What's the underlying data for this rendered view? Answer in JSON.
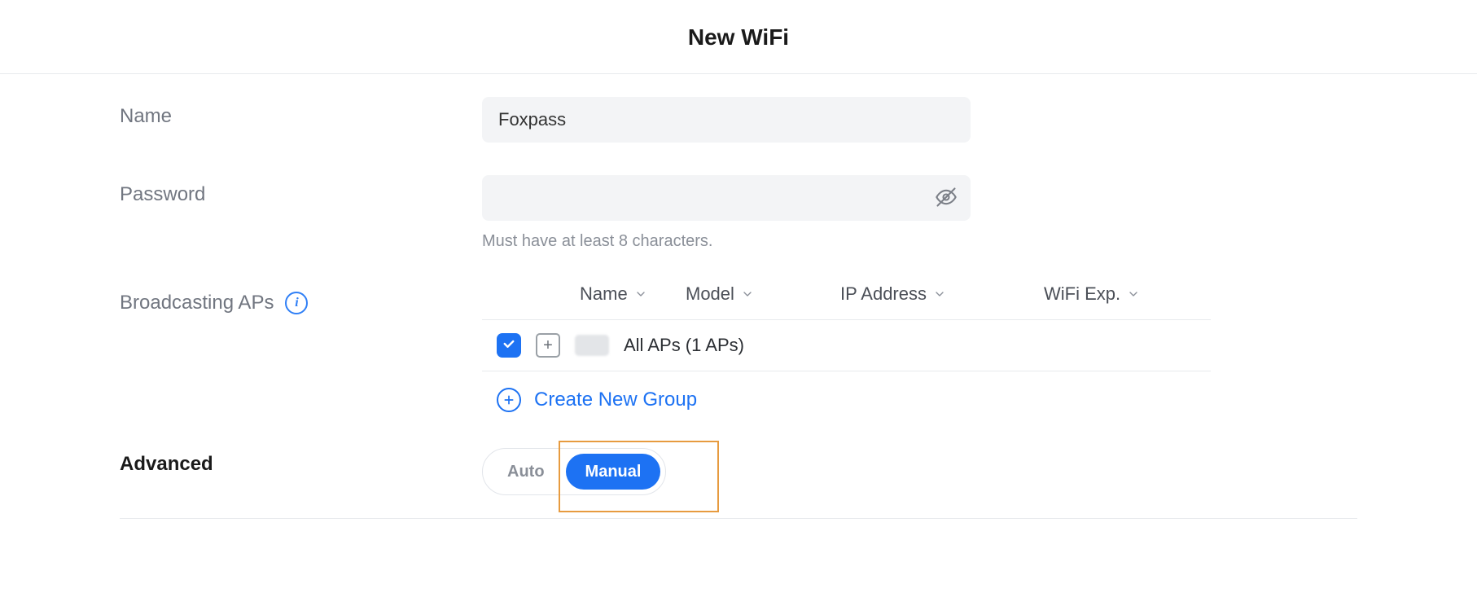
{
  "header": {
    "title": "New WiFi"
  },
  "fields": {
    "name": {
      "label": "Name",
      "value": "Foxpass"
    },
    "password": {
      "label": "Password",
      "value": "",
      "helper": "Must have at least 8 characters."
    },
    "aps": {
      "label": "Broadcasting APs",
      "columns": {
        "name": "Name",
        "model": "Model",
        "ip": "IP Address",
        "exp": "WiFi Exp."
      },
      "rows": [
        {
          "checked": true,
          "label": "All APs (1 APs)"
        }
      ],
      "create_group": "Create New Group"
    }
  },
  "advanced": {
    "label": "Advanced",
    "toggle": {
      "auto": "Auto",
      "manual": "Manual",
      "active": "manual"
    }
  },
  "colors": {
    "accent": "#1d72f3",
    "highlight": "#e79b3f"
  }
}
